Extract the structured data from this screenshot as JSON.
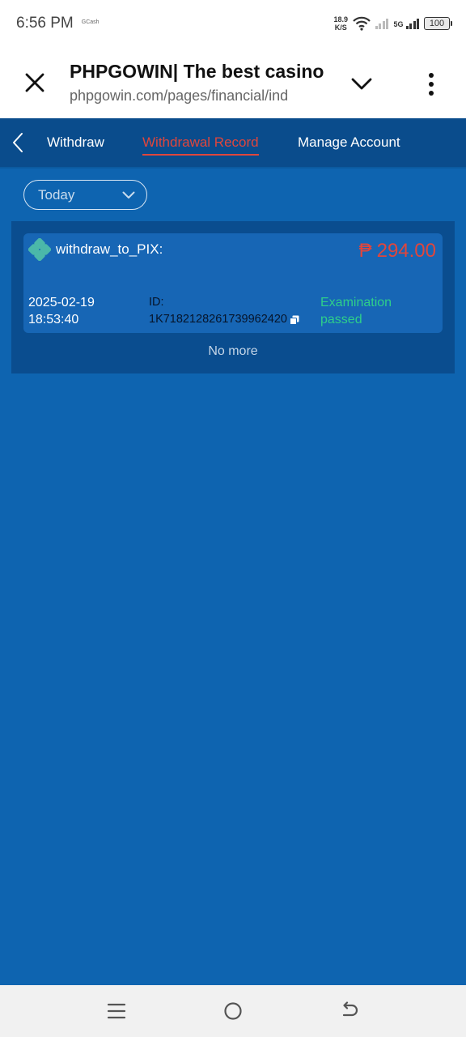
{
  "status_bar": {
    "time": "6:56 PM",
    "app_indicator": "GCash",
    "net_speed_value": "18.9",
    "net_speed_unit": "K/S",
    "network_type": "5G",
    "battery": "100"
  },
  "browser": {
    "title": "PHPGOWIN| The best casino",
    "url": "phpgowin.com/pages/financial/ind",
    "close_icon": "close-icon",
    "expand_icon": "chevron-down-icon",
    "menu_icon": "more-vert-icon"
  },
  "nav": {
    "back_icon": "chevron-left-icon",
    "tabs": [
      {
        "label": "Withdraw",
        "active": false
      },
      {
        "label": "Withdrawal Record",
        "active": true
      },
      {
        "label": "Manage Account",
        "active": false
      }
    ]
  },
  "filter": {
    "selected": "Today"
  },
  "records": [
    {
      "method": "withdraw_to_PIX:",
      "currency_symbol": "₱",
      "amount": "294.00",
      "date": "2025-02-19",
      "time": "18:53:40",
      "id_label": "ID:",
      "id_value": "1K7182128261739962420",
      "status_line1": "Examination",
      "status_line2": "passed"
    }
  ],
  "list_end_text": "No more",
  "colors": {
    "page_bg": "#0e64b0",
    "nav_bg": "#0a4c8c",
    "accent_red": "#e0463c",
    "status_green": "#2ecf8a",
    "pix_teal": "#4bb8a9"
  }
}
